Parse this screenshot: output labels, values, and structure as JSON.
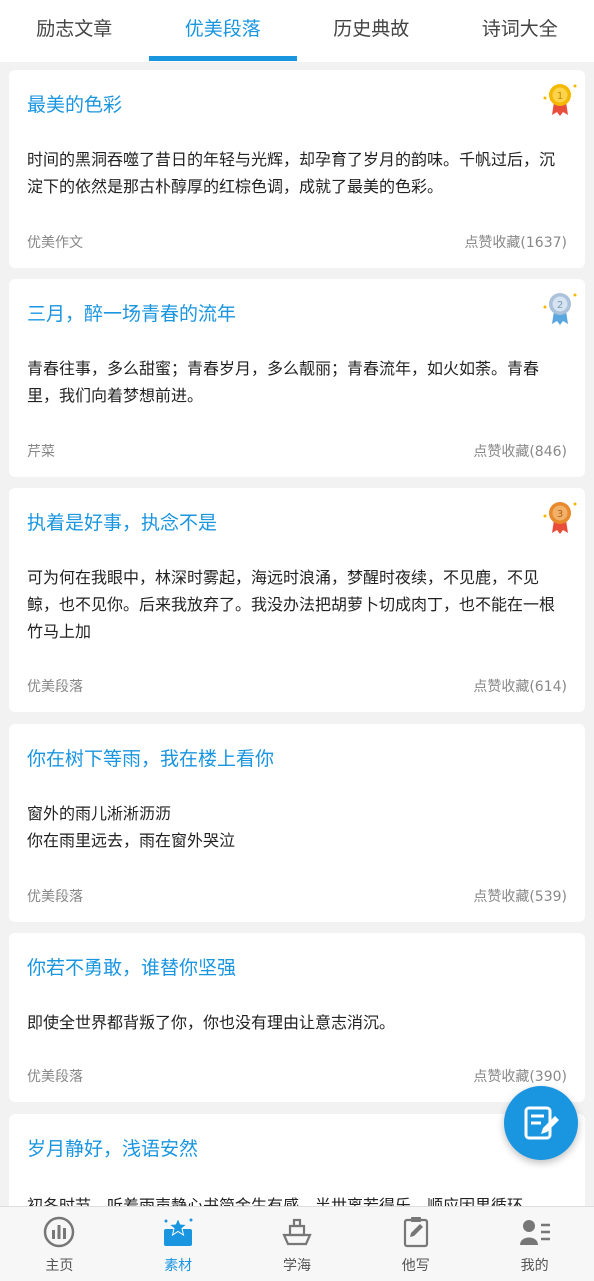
{
  "tabs": [
    "励志文章",
    "优美段落",
    "历史典故",
    "诗词大全"
  ],
  "active_tab": 1,
  "cards": [
    {
      "title": "最美的色彩",
      "body": "时间的黑洞吞噬了昔日的年轻与光辉，却孕育了岁月的韵味。千帆过后，沉淀下的依然是那古朴醇厚的红棕色调，成就了最美的色彩。",
      "source": "优美作文",
      "likes": "点赞收藏(1637)",
      "medal": "1"
    },
    {
      "title": "三月，醉一场青春的流年",
      "body": "青春往事，多么甜蜜；青春岁月，多么靓丽；青春流年，如火如荼。青春里，我们向着梦想前进。",
      "source": "芹菜",
      "likes": "点赞收藏(846)",
      "medal": "2"
    },
    {
      "title": "执着是好事，执念不是",
      "body": "可为何在我眼中，林深时雾起，海远时浪涌，梦醒时夜续，不见鹿，不见鲸，也不见你。后来我放弃了。我没办法把胡萝卜切成肉丁，也不能在一根竹马上加",
      "source": "优美段落",
      "likes": "点赞收藏(614)",
      "medal": "3"
    },
    {
      "title": "你在树下等雨，我在楼上看你",
      "body": "窗外的雨儿淅淅沥沥\n你在雨里远去，雨在窗外哭泣",
      "source": "优美段落",
      "likes": "点赞收藏(539)",
      "medal": ""
    },
    {
      "title": "你若不勇敢，谁替你坚强",
      "body": "即使全世界都背叛了你，你也没有理由让意志消沉。",
      "source": "优美段落",
      "likes": "点赞收藏(390)",
      "medal": ""
    },
    {
      "title": "岁月静好，浅语安然",
      "body": "初冬时节，听着雨声静心书简金生有感，半世离若得乐，顺应因果循环",
      "source": "",
      "likes": "",
      "medal": ""
    }
  ],
  "bottom_nav": [
    {
      "label": "主页",
      "icon": "home-chart-icon"
    },
    {
      "label": "素材",
      "icon": "material-star-icon"
    },
    {
      "label": "学海",
      "icon": "ship-icon"
    },
    {
      "label": "他写",
      "icon": "clipboard-edit-icon"
    },
    {
      "label": "我的",
      "icon": "profile-card-icon"
    }
  ],
  "active_nav": 1,
  "fab": {
    "icon": "write-note-icon"
  },
  "colors": {
    "accent": "#1a95e0",
    "gold": "#f5b800",
    "silver": "#a9c1da",
    "bronze": "#e8892b"
  }
}
